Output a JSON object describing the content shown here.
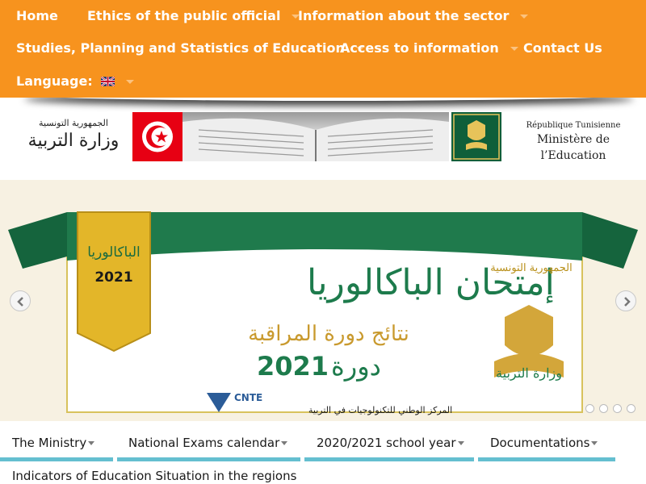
{
  "nav": {
    "home": "Home",
    "ethics": "Ethics of the public official",
    "sector_info": "Information about the sector",
    "studies": "Studies, Planning and Statistics of Education",
    "access": "Access to information",
    "contact": "Contact Us",
    "language": "Language:"
  },
  "banner": {
    "ar_small": "الجمهورية التونسية",
    "ar_big": "وزارة التربية",
    "fr_small": "République Tunisienne",
    "fr_big": "Ministère de l’Education"
  },
  "slide": {
    "badge_text": "الباكالوريا",
    "badge_year": "2021",
    "title": "إمتحان الباكالوريا",
    "subtitle": "نتائج دورة المراقبة",
    "session": "دورة",
    "year": "2021",
    "republic": "الجمهورية التونسية",
    "ministry": "وزارة التربية",
    "cnte_label": "CNTE",
    "cnte_arabic": "المركز الوطني للتكنولوجيات في التربية",
    "dot_count": 4,
    "active_dot": 0
  },
  "bottom_menu": {
    "ministry": "The Ministry",
    "exams": "National Exams calendar",
    "school_year": "2020/2021 school year",
    "docs": "Documentations",
    "indicators": "Indicators of Education Situation in the regions"
  },
  "colors": {
    "nav_bg": "#f7931e",
    "accent_bar": "#64bfd0",
    "slide_green": "#1d7b4c",
    "slide_gold": "#c99a2e"
  }
}
